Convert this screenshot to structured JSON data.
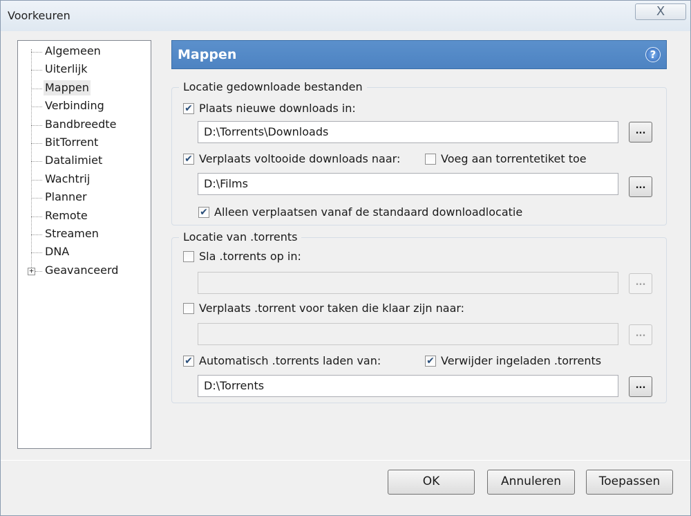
{
  "window": {
    "title": "Voorkeuren",
    "close_symbol": "X"
  },
  "tree": {
    "items": [
      {
        "label": "Algemeen"
      },
      {
        "label": "Uiterlijk"
      },
      {
        "label": "Mappen",
        "selected": true
      },
      {
        "label": "Verbinding"
      },
      {
        "label": "Bandbreedte"
      },
      {
        "label": "BitTorrent"
      },
      {
        "label": "Datalimiet"
      },
      {
        "label": "Wachtrij"
      },
      {
        "label": "Planner"
      },
      {
        "label": "Remote"
      },
      {
        "label": "Streamen"
      },
      {
        "label": "DNA"
      },
      {
        "label": "Geavanceerd",
        "expandable": true
      }
    ],
    "expander_symbol": "+"
  },
  "panel": {
    "title": "Mappen",
    "help_symbol": "?"
  },
  "download_group": {
    "label": "Locatie gedownloade bestanden",
    "new_downloads": {
      "label": "Plaats nieuwe downloads in:",
      "checked": true,
      "path": "D:\\Torrents\\Downloads"
    },
    "move_completed": {
      "label": "Verplaats voltooide downloads naar:",
      "checked": true,
      "path": "D:\\Films"
    },
    "add_label": {
      "label": "Voeg aan torrentetiket toe",
      "checked": false
    },
    "only_default": {
      "label": "Alleen verplaatsen vanaf de standaard downloadlocatie",
      "checked": true
    },
    "browse_label": "..."
  },
  "torrent_group": {
    "label": "Locatie van .torrents",
    "store_torrents": {
      "label": "Sla .torrents op in:",
      "checked": false,
      "path": ""
    },
    "move_finished": {
      "label": "Verplaats .torrent voor taken die klaar zijn naar:",
      "checked": false,
      "path": ""
    },
    "auto_load": {
      "label": "Automatisch .torrents laden van:",
      "checked": true,
      "path": "D:\\Torrents"
    },
    "delete_loaded": {
      "label": "Verwijder ingeladen .torrents",
      "checked": true
    },
    "browse_label": "..."
  },
  "buttons": {
    "ok": "OK",
    "cancel": "Annuleren",
    "apply": "Toepassen"
  }
}
